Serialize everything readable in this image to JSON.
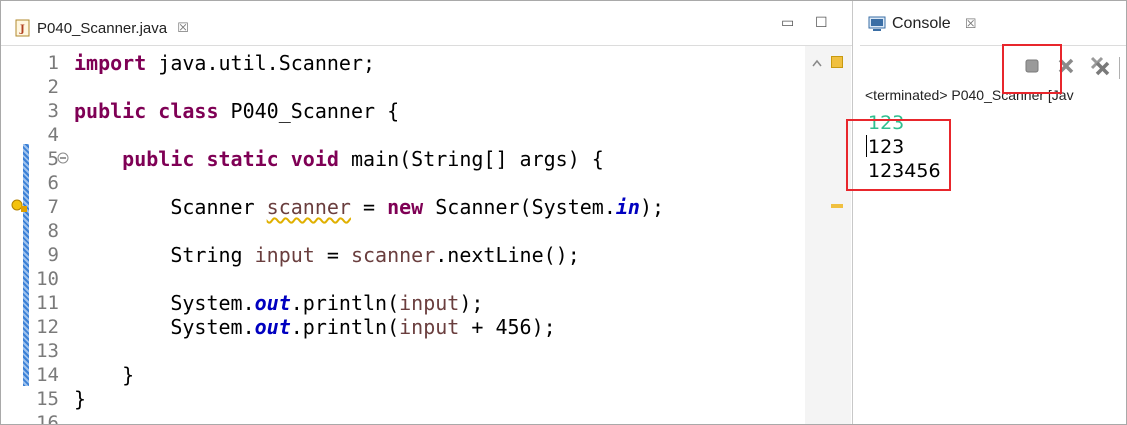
{
  "editor": {
    "tab_title": "P040_Scanner.java",
    "tab_close": "☒",
    "minimize": "▭",
    "maximize": "☐",
    "line_numbers": [
      "1",
      "2",
      "3",
      "4",
      "5",
      "6",
      "7",
      "8",
      "9",
      "10",
      "11",
      "12",
      "13",
      "14",
      "15",
      "16"
    ],
    "code": {
      "l1_kw": "import",
      "l1_rest": " java.util.Scanner;",
      "l3_kw1": "public",
      "l3_kw2": "class",
      "l3_rest": " P040_Scanner {",
      "l5_indent": "    ",
      "l5_kw1": "public",
      "l5_kw2": "static",
      "l5_kw3": "void",
      "l5_rest": " main(String[] args) {",
      "l7_a": "        Scanner ",
      "l7_var": "scanner",
      "l7_b": " = ",
      "l7_kw": "new",
      "l7_c": " Scanner(System.",
      "l7_field": "in",
      "l7_d": ");",
      "l9_a": "        String ",
      "l9_var": "input",
      "l9_b": " = ",
      "l9_var2": "scanner",
      "l9_c": ".nextLine();",
      "l11_a": "        System.",
      "l11_field": "out",
      "l11_b": ".println(",
      "l11_var": "input",
      "l11_c": ");",
      "l12_a": "        System.",
      "l12_field": "out",
      "l12_b": ".println(",
      "l12_var": "input",
      "l12_c": " + 456);",
      "l14": "    }",
      "l15": "}"
    }
  },
  "console": {
    "tab_title": "Console",
    "tab_close": "☒",
    "status": "<terminated> P040_Scanner [Jav",
    "lines": [
      {
        "text": "123",
        "color": "#2fbf8f"
      },
      {
        "text": "123",
        "color": "#000000"
      },
      {
        "text": "123456",
        "color": "#000000"
      }
    ]
  },
  "colors": {
    "keyword": "#7f0055",
    "field": "#0000c0",
    "highlight": "#e8262c",
    "input_text": "#2fbf8f"
  }
}
